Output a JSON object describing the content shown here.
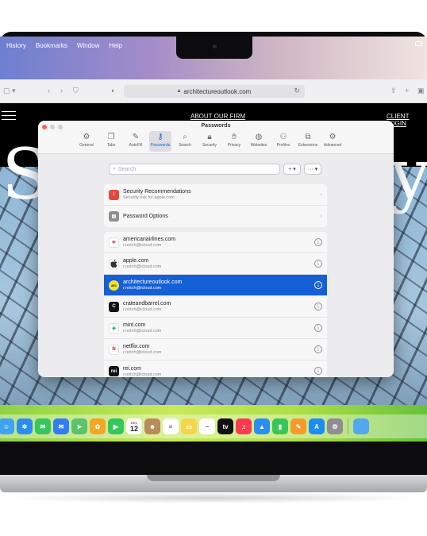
{
  "menubar": {
    "items": [
      "History",
      "Bookmarks",
      "Window",
      "Help"
    ]
  },
  "safari": {
    "url": "architectureoutlook.com"
  },
  "website": {
    "nav_left": "ABOUT OUR FIRM",
    "nav_right": "CLIENT LOGIN",
    "hero_letters": [
      "S",
      "y"
    ]
  },
  "passwords_window": {
    "title": "Passwords",
    "tabs": [
      {
        "label": "General",
        "icon": "gear-icon",
        "glyph": "⚙"
      },
      {
        "label": "Tabs",
        "icon": "tabs-icon",
        "glyph": "❐"
      },
      {
        "label": "AutoFill",
        "icon": "autofill-icon",
        "glyph": "✎"
      },
      {
        "label": "Passwords",
        "icon": "key-icon",
        "glyph": "⚷",
        "active": true
      },
      {
        "label": "Search",
        "icon": "search-icon",
        "glyph": "⌕"
      },
      {
        "label": "Security",
        "icon": "lock-icon",
        "glyph": "🔒︎"
      },
      {
        "label": "Privacy",
        "icon": "hand-icon",
        "glyph": "✋︎"
      },
      {
        "label": "Websites",
        "icon": "globe-icon",
        "glyph": "◍"
      },
      {
        "label": "Profiles",
        "icon": "person-icon",
        "glyph": "⚇"
      },
      {
        "label": "Extensions",
        "icon": "puzzle-icon",
        "glyph": "⧉"
      },
      {
        "label": "Advanced",
        "icon": "gears-icon",
        "glyph": "⚙"
      }
    ],
    "search_placeholder": "Search",
    "add_button": "+ ▾",
    "more_button": "··· ▾",
    "top_group": [
      {
        "title": "Security Recommendations",
        "subtitle": "Security risk for apple.com",
        "icon": "warning-icon",
        "color": "#e5483d"
      },
      {
        "title": "Password Options",
        "subtitle": "",
        "icon": "options-icon",
        "color": "#8e8e93"
      }
    ],
    "accounts": [
      {
        "site": "americanairlines.com",
        "user": "r.notch@icloud.com",
        "avatar": "aa-logo",
        "avatar_text": "✈",
        "color": "#ffffff",
        "text_color": "#c8102e"
      },
      {
        "site": "apple.com",
        "user": "r.notch@icloud.com",
        "avatar": "apple-logo",
        "avatar_text": "",
        "color": "#ffffff",
        "text_color": "#333333"
      },
      {
        "site": "architectureoutlook.com",
        "user": "r.notch@icloud.com",
        "avatar": "arc-logo",
        "avatar_text": "arc",
        "color": "#f5e12a",
        "text_color": "#111111",
        "selected": true
      },
      {
        "site": "crateandbarrel.com",
        "user": "r.notch@icloud.com",
        "avatar": "crate-logo",
        "avatar_text": "C",
        "color": "#111111",
        "text_color": "#ffffff"
      },
      {
        "site": "mint.com",
        "user": "r.notch@icloud.com",
        "avatar": "mint-logo",
        "avatar_text": "◆",
        "color": "#ffffff",
        "text_color": "#2bbf6a"
      },
      {
        "site": "netflix.com",
        "user": "r.notch@icloud.com",
        "avatar": "netflix-logo",
        "avatar_text": "N",
        "color": "#ffffff",
        "text_color": "#e50914"
      },
      {
        "site": "rei.com",
        "user": "r.notch@icloud.com",
        "avatar": "rei-logo",
        "avatar_text": "rei",
        "color": "#111111",
        "text_color": "#ffffff"
      }
    ]
  },
  "dock": {
    "calendar_month": "DEC",
    "calendar_day": "12",
    "apps": [
      {
        "name": "finder",
        "color": "#3fa2f2",
        "glyph": "☺"
      },
      {
        "name": "safari",
        "color": "#2d8cf0",
        "glyph": "✲"
      },
      {
        "name": "messages",
        "color": "#35c759",
        "glyph": "✉"
      },
      {
        "name": "mail",
        "color": "#2f7cf6",
        "glyph": "✉"
      },
      {
        "name": "maps",
        "color": "#5ac36b",
        "glyph": "➤"
      },
      {
        "name": "photos",
        "color": "#f6a623",
        "glyph": "✿"
      },
      {
        "name": "facetime",
        "color": "#36c759",
        "glyph": "▶"
      },
      {
        "name": "calendar",
        "color": "#ffffff",
        "glyph": ""
      },
      {
        "name": "contacts",
        "color": "#b98a5a",
        "glyph": "☻"
      },
      {
        "name": "reminders",
        "color": "#ffffff",
        "glyph": "≡"
      },
      {
        "name": "notes",
        "color": "#f7d54a",
        "glyph": "▭"
      },
      {
        "name": "freeform",
        "color": "#ffffff",
        "glyph": "~"
      },
      {
        "name": "appletv",
        "color": "#111111",
        "glyph": "tv"
      },
      {
        "name": "music",
        "color": "#fa3a52",
        "glyph": "♫"
      },
      {
        "name": "keynote",
        "color": "#2b8ef2",
        "glyph": "▲"
      },
      {
        "name": "numbers",
        "color": "#36c759",
        "glyph": "▮"
      },
      {
        "name": "pages",
        "color": "#f79a2a",
        "glyph": "✎"
      },
      {
        "name": "appstore",
        "color": "#1d8cf4",
        "glyph": "A"
      },
      {
        "name": "settings",
        "color": "#8e8e93",
        "glyph": "⚙"
      }
    ]
  }
}
